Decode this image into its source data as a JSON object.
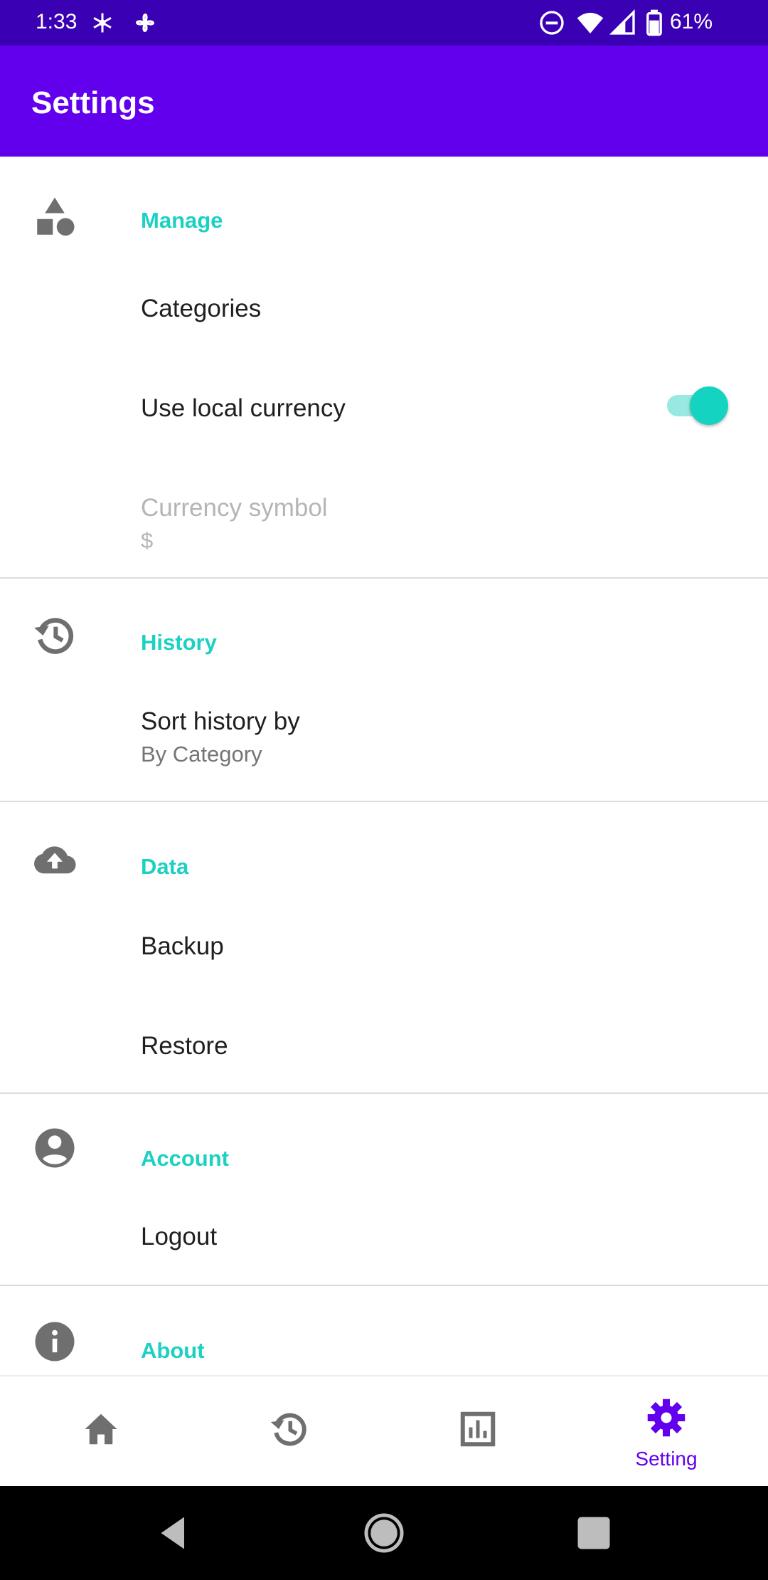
{
  "status_bar": {
    "time": "1:33",
    "battery": "61%",
    "icons": [
      "snowflake-icon",
      "fan-icon",
      "do-not-disturb-icon",
      "wifi-icon",
      "signal-icon",
      "battery-icon"
    ]
  },
  "app_bar": {
    "title": "Settings"
  },
  "sections": {
    "manage": {
      "title": "Manage",
      "icon": "shapes-icon",
      "categories": {
        "title": "Categories"
      },
      "local_currency": {
        "title": "Use local currency",
        "enabled": true
      },
      "currency_symbol": {
        "title": "Currency symbol",
        "summary": "$"
      }
    },
    "history": {
      "title": "History",
      "icon": "history-icon",
      "sort_by": {
        "title": "Sort history by",
        "summary": "By Category"
      }
    },
    "data": {
      "title": "Data",
      "icon": "cloud-upload-icon",
      "backup": {
        "title": "Backup"
      },
      "restore": {
        "title": "Restore"
      }
    },
    "account": {
      "title": "Account",
      "icon": "account-circle-icon",
      "logout": {
        "title": "Logout"
      }
    },
    "about": {
      "title": "About",
      "icon": "info-icon"
    }
  },
  "bottom_nav": {
    "items": [
      {
        "id": "home",
        "icon": "home-icon"
      },
      {
        "id": "history",
        "icon": "history-icon"
      },
      {
        "id": "stats",
        "icon": "bar-chart-icon"
      },
      {
        "id": "setting",
        "icon": "gear-icon",
        "label": "Setting",
        "active": true
      }
    ]
  },
  "colors": {
    "status_bar": "#3a00b3",
    "primary": "#6200ee",
    "accent": "#1cd1c2",
    "icon_gray": "#6f6f6f"
  }
}
